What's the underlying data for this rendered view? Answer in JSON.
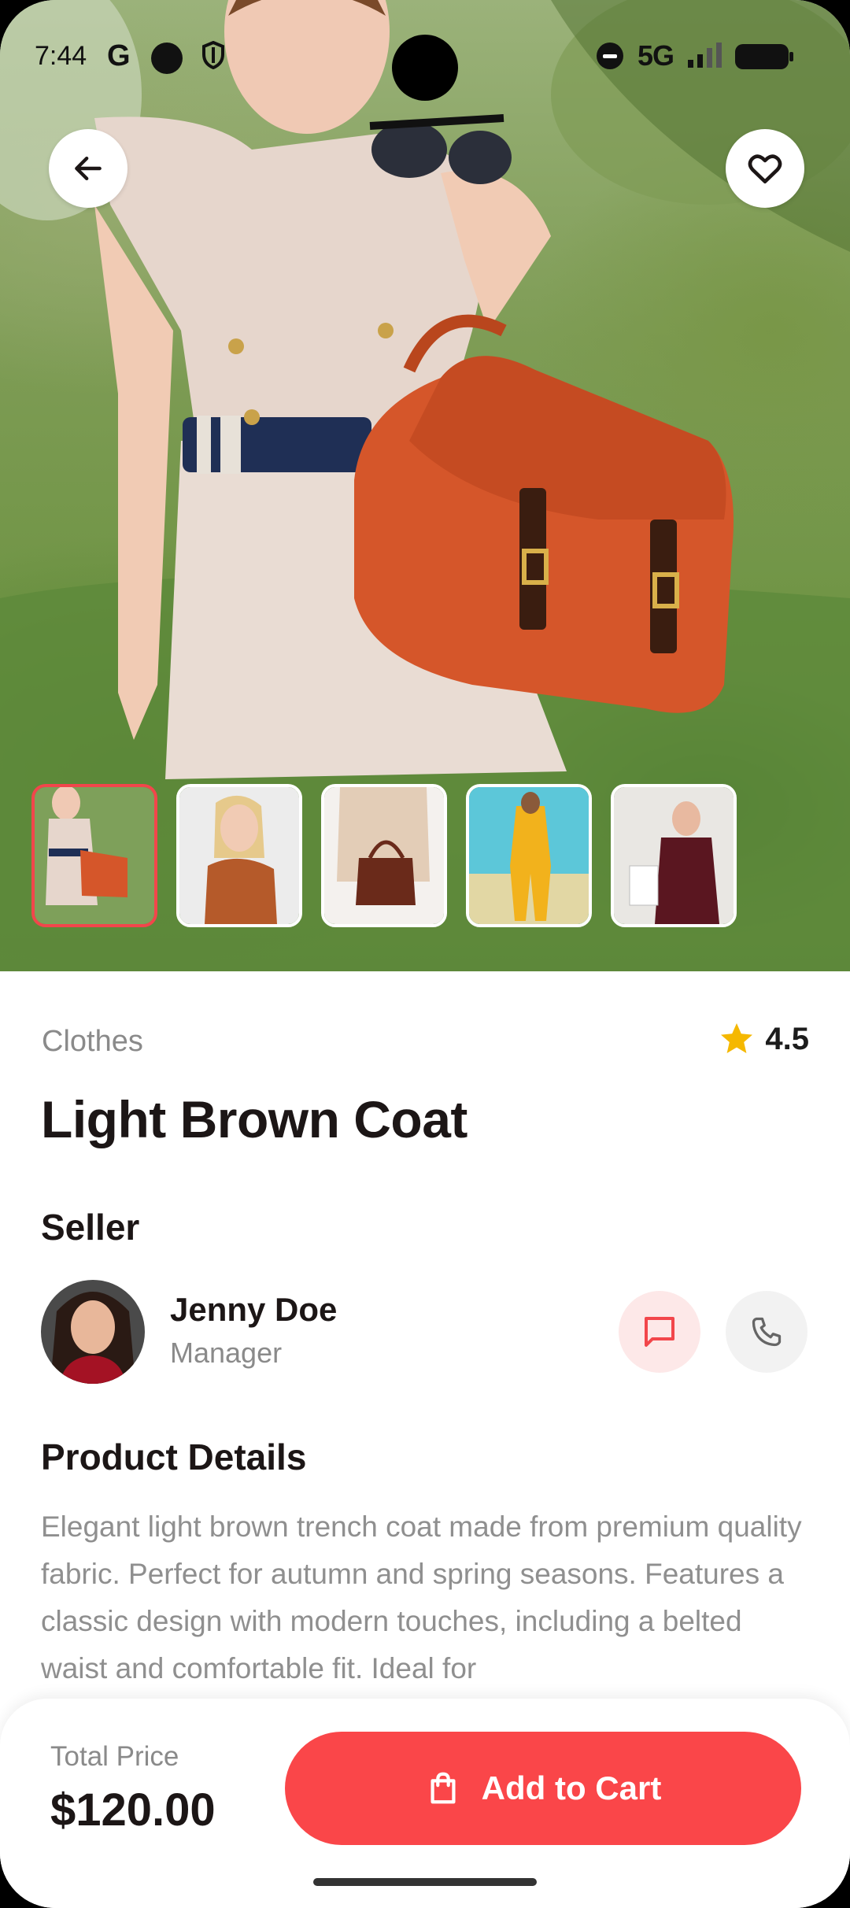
{
  "status_bar": {
    "time": "7:44",
    "google_glyph": "G",
    "network": "5G",
    "icons": [
      "dot-icon",
      "shield-icon",
      "dnd-icon",
      "signal-icon",
      "battery-icon"
    ]
  },
  "hero": {
    "description_icons": [
      "back-arrow-icon",
      "heart-icon"
    ],
    "selected_thumbnail": 0,
    "thumbnail_count": 5
  },
  "product": {
    "category": "Clothes",
    "rating": "4.5",
    "title": "Light Brown Coat"
  },
  "seller": {
    "heading": "Seller",
    "name": "Jenny Doe",
    "role": "Manager"
  },
  "details": {
    "heading": "Product Details",
    "text": "Elegant light brown trench coat made from premium quality fabric. Perfect for autumn and spring seasons. Features a classic design with modern touches, including a belted waist and comfortable fit. Ideal for"
  },
  "checkout": {
    "total_label": "Total Price",
    "total_price": "$120.00",
    "cart_label": "Add to Cart"
  },
  "colors": {
    "accent": "#fa4649",
    "star": "#f5b800",
    "text_dark": "#1c1616",
    "text_muted": "#8a8a8a"
  }
}
